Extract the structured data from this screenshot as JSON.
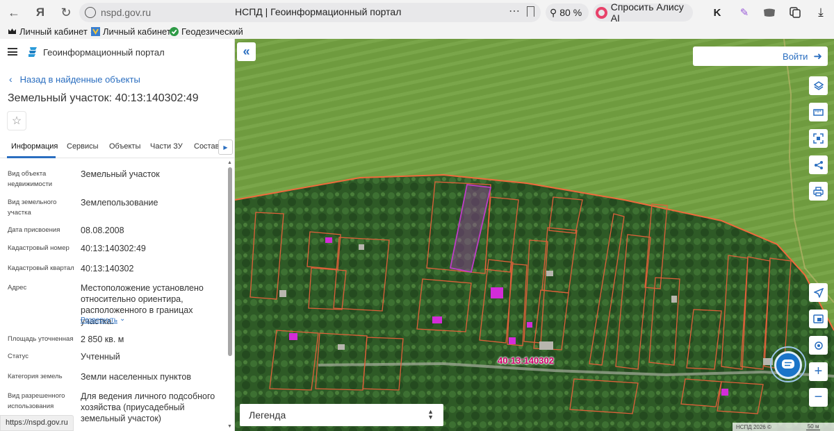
{
  "browser": {
    "url": "nspd.gov.ru",
    "page_title": "НСПД | Геоинформационный портал",
    "zoom": "80 %",
    "alice_button": "Спросить Алису AI",
    "status_url": "https://nspd.gov.ru"
  },
  "bookmarks": [
    {
      "label": "Личный кабинет"
    },
    {
      "label": "Личный кабинет"
    },
    {
      "label": "Геодезический к"
    }
  ],
  "panel": {
    "portal_name": "Геоинформационный портал",
    "back_link": "Назад в найденные объекты",
    "heading": "Земельный участок: 40:13:140302:49",
    "tabs": [
      "Информация",
      "Сервисы",
      "Объекты",
      "Части ЗУ",
      "Состав"
    ],
    "rows": [
      {
        "key": "Вид объекта недвижимости",
        "value": "Земельный участок"
      },
      {
        "key": "Вид земельного участка",
        "value": "Землепользование"
      },
      {
        "key": "Дата присвоения",
        "value": "08.08.2008"
      },
      {
        "key": "Кадастровый номер",
        "value": "40:13:140302:49"
      },
      {
        "key": "Кадастровый квартал",
        "value": "40:13:140302"
      },
      {
        "key": "Адрес",
        "value": "Местоположение установлено относительно ориентира, расположенного в границах участка."
      },
      {
        "key": "Площадь уточненная",
        "value": "2 850 кв. м"
      },
      {
        "key": "Статус",
        "value": "Учтенный"
      },
      {
        "key": "Категория земель",
        "value": "Земли населенных пунктов"
      },
      {
        "key": "Вид разрешенного использования",
        "value": "Для ведения личного подсобного хозяйства (приусадебный земельный участок)"
      }
    ],
    "expand_link": "Развернуть"
  },
  "map": {
    "login_label": "Войти",
    "legend_label": "Легенда",
    "cadastral_label": "40:13:140302",
    "copyright": "НСПД 2026 ©",
    "scale_label": "50 м",
    "colors": {
      "parcel": "#e0603a",
      "selected": "#c03cc8",
      "field": "#6e9a3e",
      "forest": "#2f5a26"
    }
  }
}
